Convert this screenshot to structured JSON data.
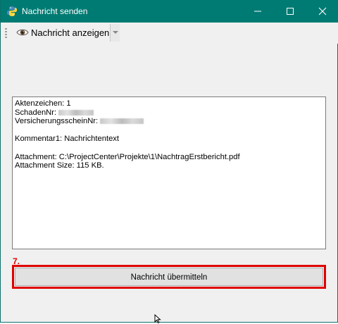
{
  "window": {
    "title": "Nachricht senden",
    "icon": "python-icon",
    "titlebar_color": "#007b73"
  },
  "toolbar": {
    "show_button_label": "Nachricht anzeigen",
    "show_button_icon": "eye-icon"
  },
  "message": {
    "line1": "Aktenzeichen: 1",
    "line2_label": "SchadenNr: ",
    "line3_label": "VersicherungsscheinNr: ",
    "line4": "Kommentar1: Nachrichtentext",
    "line5": "Attachment: C:\\ProjectCenter\\Projekte\\1\\NachtragErstbericht.pdf",
    "line6": "Attachment Size: 115 KB."
  },
  "annotation": {
    "step": "7.",
    "color": "#e00000"
  },
  "send_button": {
    "label": "Nachricht übermitteln"
  }
}
